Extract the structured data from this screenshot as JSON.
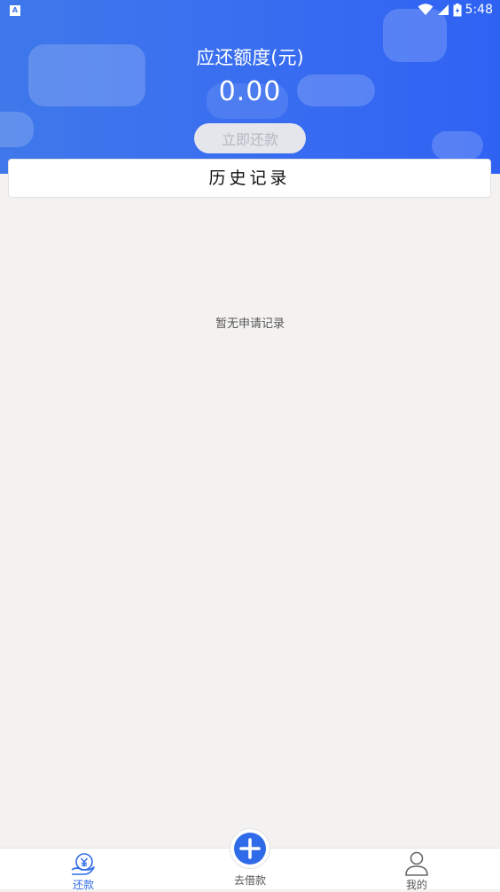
{
  "status_bar": {
    "time": "5:48",
    "app_icon_letter": "A"
  },
  "header": {
    "amount_label": "应还额度(元)",
    "amount_value": "0.00",
    "repay_button": "立即还款"
  },
  "history": {
    "title": "历史记录",
    "empty_text": "暂无申请记录"
  },
  "tabbar": {
    "tabs": [
      {
        "label": "还款",
        "icon": "repay-icon",
        "active": true
      },
      {
        "label": "去借款",
        "icon": "plus-icon",
        "active": false
      },
      {
        "label": "我的",
        "icon": "user-icon",
        "active": false
      }
    ]
  },
  "colors": {
    "primary": "#2f6be8",
    "header_gradient_start": "#3f78ea",
    "header_gradient_end": "#2f62f3",
    "inactive_tab": "#555555",
    "page_background": "#f4f2f1"
  }
}
